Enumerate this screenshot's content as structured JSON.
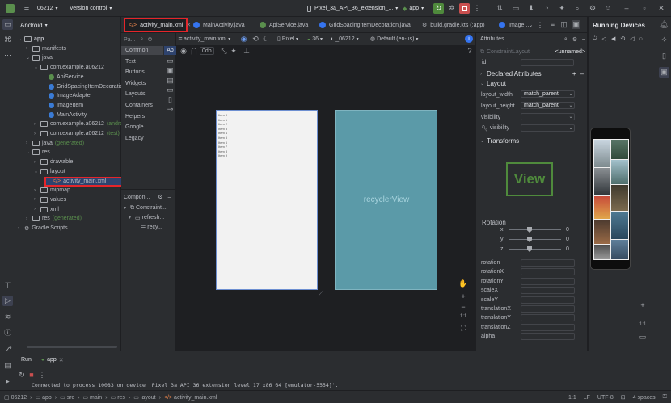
{
  "titlebar": {
    "project": "06212",
    "vcs": "Version control",
    "device": "Pixel_3a_API_36_extension_...",
    "run_config": "app"
  },
  "tabs": [
    {
      "label": "activity_main.xml",
      "active": true
    },
    {
      "label": "MainActivity.java"
    },
    {
      "label": "ApiService.java"
    },
    {
      "label": "GridSpacingItemDecoration.java"
    },
    {
      "label": "build.gradle.kts (:app)"
    },
    {
      "label": "Image..."
    }
  ],
  "project_panel": {
    "view": "Android",
    "tree": [
      {
        "label": "app",
        "indent": 0,
        "kind": "module"
      },
      {
        "label": "manifests",
        "indent": 1,
        "kind": "folder"
      },
      {
        "label": "java",
        "indent": 1,
        "kind": "folder"
      },
      {
        "label": "com.example.a06212",
        "indent": 2,
        "kind": "folder"
      },
      {
        "label": "ApiService",
        "indent": 3,
        "kind": "interface"
      },
      {
        "label": "GridSpacingItemDecoration",
        "indent": 3,
        "kind": "class"
      },
      {
        "label": "ImageAdapter",
        "indent": 3,
        "kind": "class"
      },
      {
        "label": "ImageItem",
        "indent": 3,
        "kind": "class"
      },
      {
        "label": "MainActivity",
        "indent": 3,
        "kind": "class"
      },
      {
        "label": "com.example.a06212",
        "suffix": "(androidTest)",
        "indent": 2,
        "kind": "folder"
      },
      {
        "label": "com.example.a06212",
        "suffix": "(test)",
        "indent": 2,
        "kind": "folder"
      },
      {
        "label": "java",
        "suffix": "(generated)",
        "indent": 1,
        "kind": "folder"
      },
      {
        "label": "res",
        "indent": 1,
        "kind": "folder"
      },
      {
        "label": "drawable",
        "indent": 2,
        "kind": "folder"
      },
      {
        "label": "layout",
        "indent": 2,
        "kind": "folder"
      },
      {
        "label": "activity_main.xml",
        "indent": 3,
        "kind": "xml",
        "selected": true
      },
      {
        "label": "mipmap",
        "indent": 2,
        "kind": "folder"
      },
      {
        "label": "values",
        "indent": 2,
        "kind": "folder"
      },
      {
        "label": "xml",
        "indent": 2,
        "kind": "folder"
      },
      {
        "label": "res",
        "suffix": "(generated)",
        "indent": 1,
        "kind": "folder"
      },
      {
        "label": "Gradle Scripts",
        "indent": 0,
        "kind": "gradle"
      }
    ]
  },
  "palette": {
    "search": "Pa...",
    "categories": [
      "Common",
      "Text",
      "Buttons",
      "Widgets",
      "Layouts",
      "Containers",
      "Helpers",
      "Google",
      "Legacy"
    ],
    "first_item": "Ab"
  },
  "component_tree": {
    "title": "Compon...",
    "items": [
      "Constraint...",
      "refresh...",
      "recy..."
    ]
  },
  "design_toolbar": {
    "file": "activity_main.xml",
    "margin": "0dp",
    "device": "Pixel",
    "api": "36",
    "theme": "_06212",
    "locale": "Default (en-us)"
  },
  "canvas": {
    "items": [
      "Item 0",
      "Item 1",
      "Item 2",
      "Item 3",
      "Item 4",
      "Item 5",
      "Item 6",
      "Item 7",
      "Item 8",
      "Item 9"
    ],
    "blueprint_label": "recyclerView",
    "zoom": "1:1"
  },
  "attributes": {
    "title": "Attributes",
    "class_name": "ConstraintLayout",
    "unnamed": "<unnamed>",
    "id_label": "id",
    "declared": "Declared Attributes",
    "layout": "Layout",
    "layout_width_label": "layout_width",
    "layout_width": "match_parent",
    "layout_height_label": "layout_height",
    "layout_height": "match_parent",
    "visibility_label": "visibility",
    "visibility2_label": "visibility",
    "transforms": "Transforms",
    "view_label": "View",
    "rotation": "Rotation",
    "axes": [
      "x",
      "y",
      "z"
    ],
    "axis_values": [
      "0",
      "0",
      "0"
    ],
    "props": [
      "rotation",
      "rotationX",
      "rotationY",
      "scaleX",
      "scaleY",
      "translationX",
      "translationY",
      "translationZ",
      "alpha"
    ]
  },
  "running_devices": {
    "title": "Running Devices"
  },
  "run_panel": {
    "run_label": "Run",
    "config": "app",
    "log": "Connected to process 10083 on device 'Pixel_3a_API_36_extension_level_17_x86_64 [emulator-5554]'."
  },
  "statusbar": {
    "breadcrumbs": [
      "06212",
      "app",
      "src",
      "main",
      "res",
      "layout",
      "activity_main.xml"
    ],
    "position": "1:1",
    "line_sep": "LF",
    "encoding": "UTF-8",
    "indent": "4 spaces"
  },
  "colors": {
    "accent": "#3574f0",
    "highlight": "#e5252a",
    "blueprint": "#5b9aa8",
    "selected_row": "#2e436e"
  }
}
